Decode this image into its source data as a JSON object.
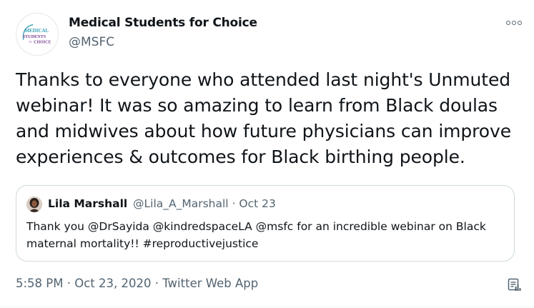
{
  "author": {
    "name": "Medical Students for Choice",
    "handle": "@MSFC",
    "avatar_logo_text": "MEDICAL STUDENTS for CHOICE"
  },
  "tweet": {
    "text": "Thanks to everyone who attended last night's Unmuted webinar! It was so amazing to learn from Black doulas and midwives about how future physicians can improve experiences & outcomes for Black birthing people."
  },
  "quoted_tweet": {
    "name": "Lila Marshall",
    "handle_and_date": "@Lila_A_Marshall · Oct 23",
    "text": "Thank you @DrSayida @kindredspaceLA @msfc for an incredible webinar on Black maternal mortality!! #reproductivejustice"
  },
  "footer": {
    "timestamp_and_source": "5:58 PM · Oct 23, 2020 · Twitter Web App"
  },
  "icons": {
    "more": "more-icon",
    "analytics": "analytics-icon"
  },
  "colors": {
    "text_primary": "#0f1419",
    "text_secondary": "#536471",
    "border": "#cfd9de",
    "logo_teal": "#3a9fb4",
    "logo_purple": "#7a3f8f"
  }
}
